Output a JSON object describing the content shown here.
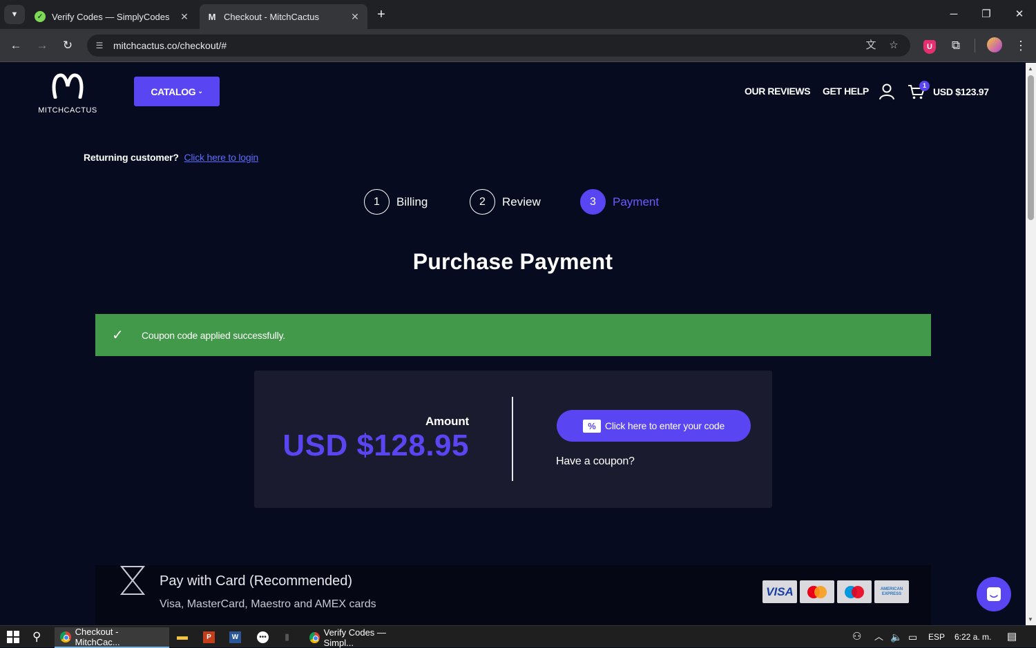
{
  "browser": {
    "tabs": [
      {
        "title": "Verify Codes — SimplyCodes",
        "active": false
      },
      {
        "title": "Checkout - MitchCactus",
        "active": true
      }
    ],
    "url": "mitchcactus.co/checkout/#"
  },
  "header": {
    "logo_text": "MITCHCACTUS",
    "catalog_label": "CATALOG",
    "nav": [
      "OUR REVIEWS",
      "GET HELP"
    ],
    "cart_count": "1",
    "cart_total": "USD $123.97"
  },
  "returning": {
    "label": "Returning customer?",
    "link": "Click here to login"
  },
  "steps": [
    {
      "num": "1",
      "label": "Billing",
      "active": false
    },
    {
      "num": "2",
      "label": "Review",
      "active": false
    },
    {
      "num": "3",
      "label": "Payment",
      "active": true
    }
  ],
  "page_title": "Purchase Payment",
  "notice": {
    "text": "Coupon code applied successfully.",
    "color": "#43994a"
  },
  "payment": {
    "amount_label": "Amount",
    "amount": "USD $128.95",
    "coupon_button": "Click here to enter your code",
    "coupon_prompt": "Have a coupon?"
  },
  "card_option": {
    "title": "Pay with Card (Recommended)",
    "subtitle": "Visa, MasterCard, Maestro and AMEX cards",
    "cards": [
      "visa-icon",
      "mastercard-icon",
      "maestro-icon",
      "amex-icon"
    ],
    "visa_text": "VISA",
    "amex_text": "AMERICAN EXPRESS"
  },
  "taskbar": {
    "apps": [
      {
        "title": "Checkout - MitchCac...",
        "active": true
      },
      {
        "title": "Verify Codes — Simpl...",
        "active": false
      }
    ],
    "language": "ESP",
    "time": "6:22 a. m."
  },
  "colors": {
    "accent": "#5a45f2",
    "background": "#070b1f",
    "panel": "#1a1b2e",
    "success": "#43994a"
  }
}
